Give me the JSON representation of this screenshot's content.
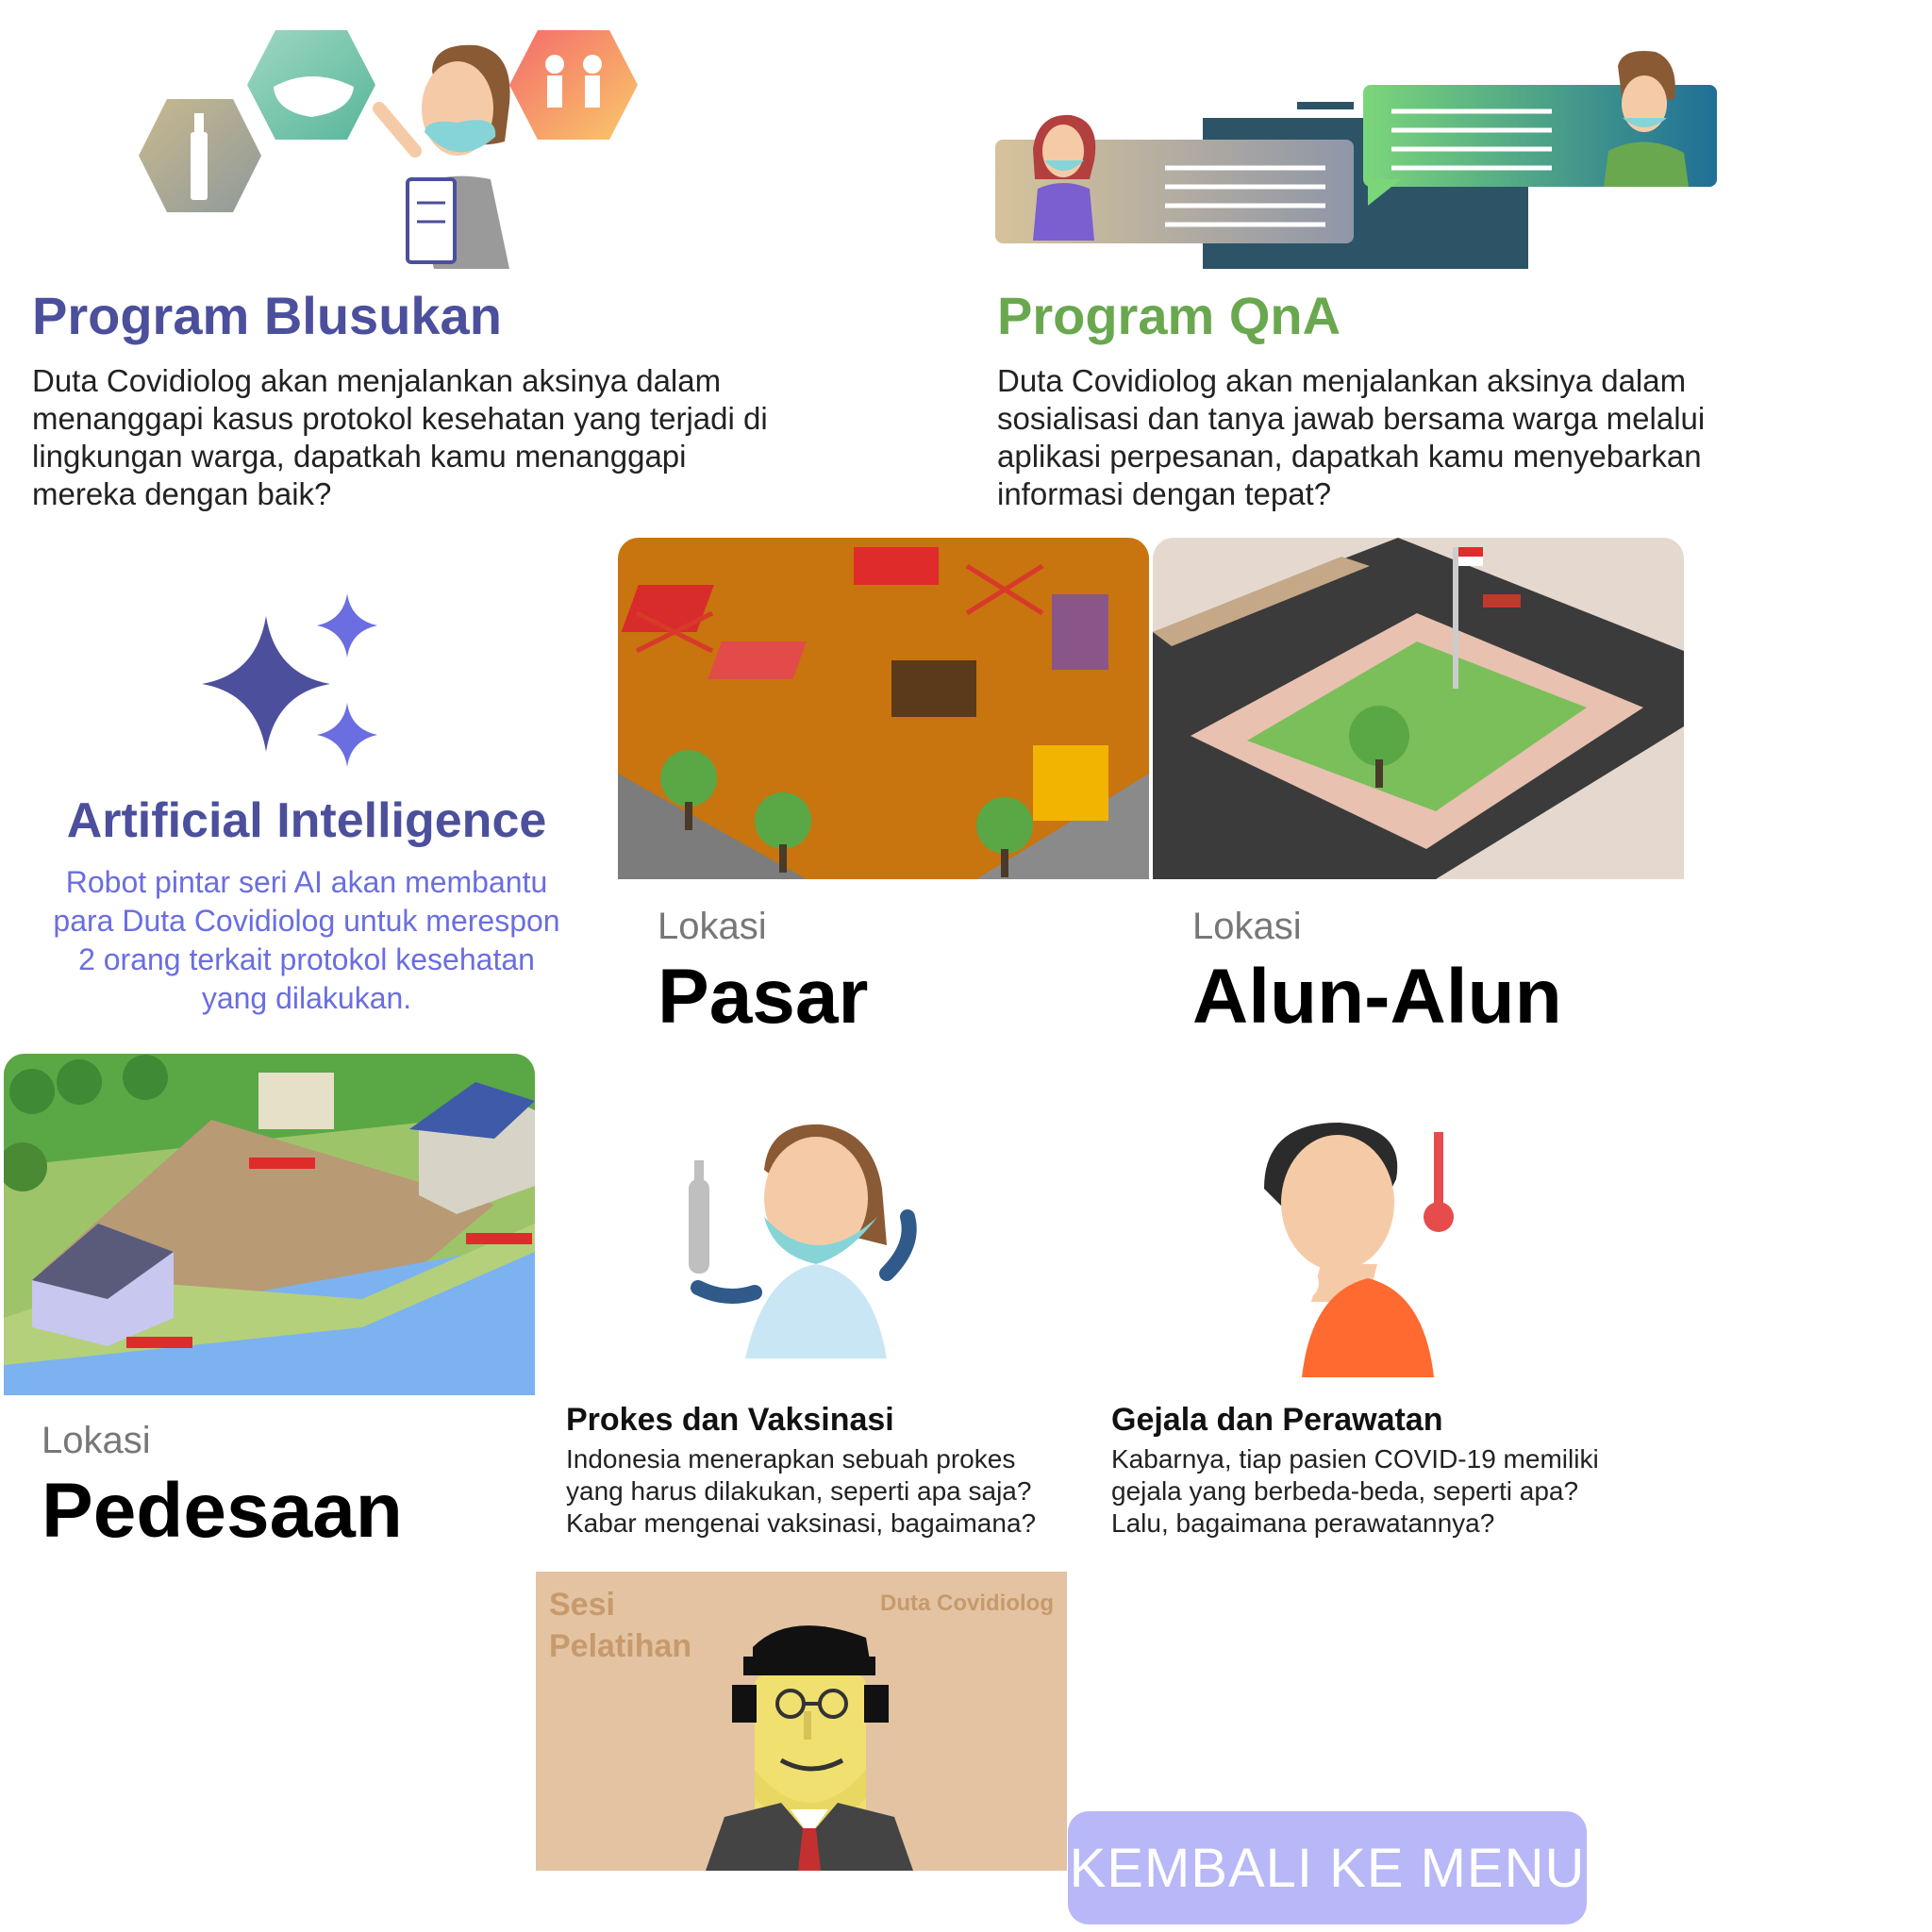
{
  "blusukan": {
    "title": "Program Blusukan",
    "description": "Duta Covidiolog akan menjalankan aksinya dalam menanggapi kasus protokol kesehatan yang terjadi di lingkungan warga, dapatkah kamu menanggapi mereka dengan baik?",
    "color": "#4b4f9c"
  },
  "qna": {
    "title": "Program QnA",
    "description": "Duta Covidiolog akan menjalankan aksinya dalam sosialisasi dan tanya jawab bersama warga melalui aplikasi perpesanan, dapatkah kamu menyebarkan informasi dengan tepat?",
    "color": "#6aa84f"
  },
  "ai": {
    "title": "Artificial Intelligence",
    "description": "Robot pintar seri AI akan membantu para Duta Covidiolog untuk merespon 2 orang terkait protokol kesehatan yang dilakukan.",
    "color": "#4b4f9c",
    "desc_color": "#6a6ee0"
  },
  "locations": {
    "pasar": {
      "small": "Lokasi",
      "name": "Pasar"
    },
    "alun": {
      "small": "Lokasi",
      "name": "Alun-Alun"
    },
    "desa": {
      "small": "Lokasi",
      "name": "Pedesaan"
    }
  },
  "cards": {
    "prokes": {
      "title": "Prokes dan Vaksinasi",
      "description": "Indonesia menerapkan sebuah prokes yang harus dilakukan, seperti apa saja? Kabar mengenai vaksinasi, bagaimana?"
    },
    "gejala": {
      "title": "Gejala dan Perawatan",
      "description": "Kabarnya, tiap pasien COVID-19 memiliki gejala yang berbeda-beda, seperti apa? Lalu, bagaimana perawatannya?"
    }
  },
  "training": {
    "title_line1": "Sesi",
    "title_line2": "Pelatihan",
    "brand": "Duta Covidiolog"
  },
  "back_button": {
    "label": "KEMBALI KE MENU"
  }
}
